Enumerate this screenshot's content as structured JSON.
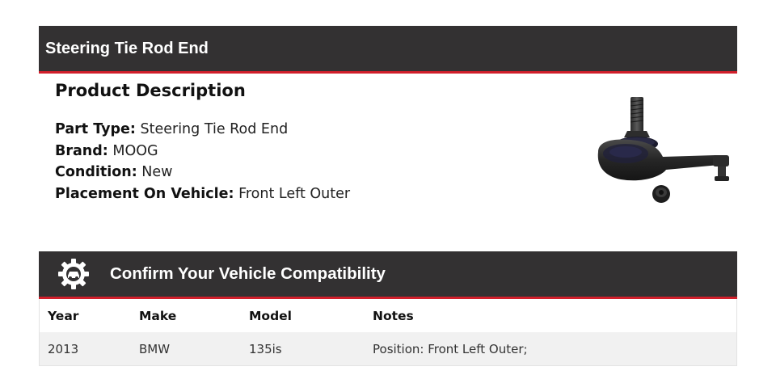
{
  "header": {
    "title": "Steering Tie Rod End"
  },
  "product": {
    "heading": "Product Description",
    "attributes": [
      {
        "label": "Part Type:",
        "value": "Steering Tie Rod End"
      },
      {
        "label": "Brand:",
        "value": "MOOG"
      },
      {
        "label": "Condition:",
        "value": "New"
      },
      {
        "label": "Placement On Vehicle:",
        "value": "Front Left Outer"
      }
    ]
  },
  "compatibility": {
    "title": "Confirm Your Vehicle Compatibility",
    "icon": "gear-car-icon",
    "columns": [
      "Year",
      "Make",
      "Model",
      "Notes"
    ],
    "rows": [
      [
        "2013",
        "BMW",
        "135is",
        "Position: Front Left Outer;"
      ]
    ]
  },
  "colors": {
    "bar_bg": "#333132",
    "accent_red": "#d11f2b",
    "row_alt_bg": "#f1f1f1"
  }
}
